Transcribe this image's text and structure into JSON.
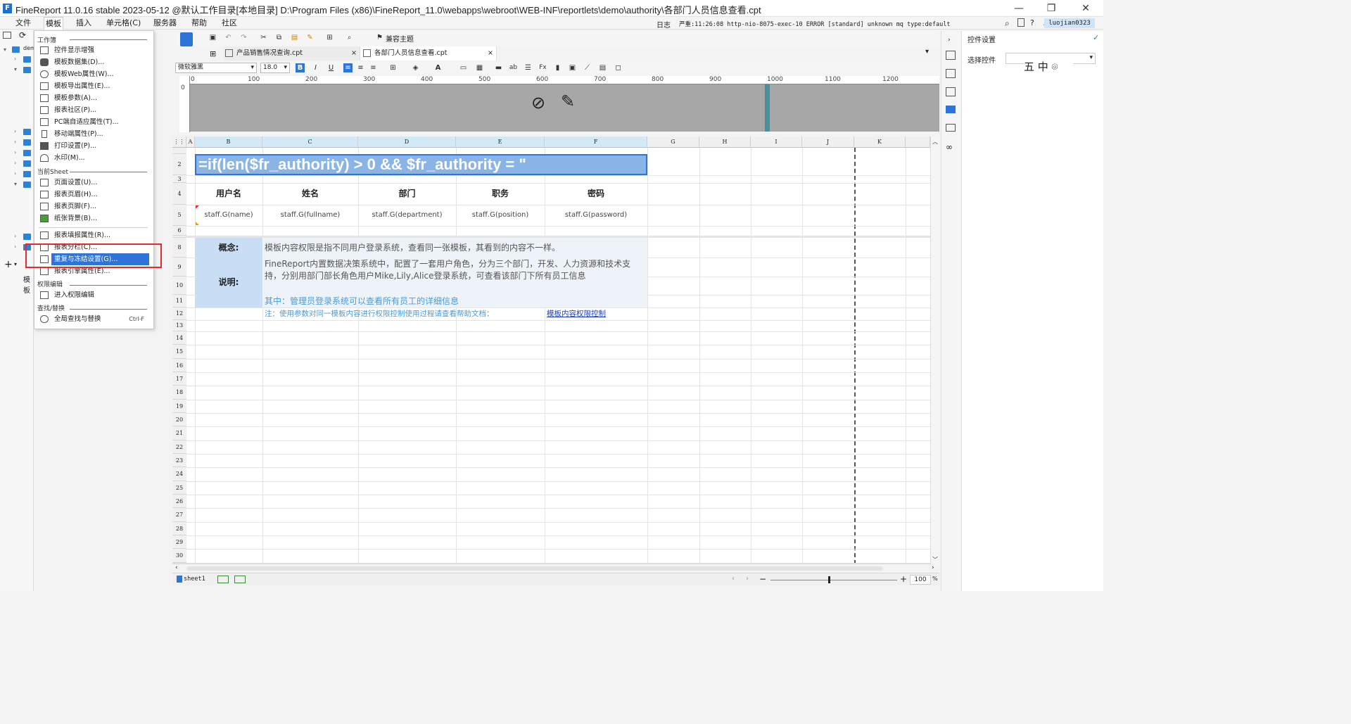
{
  "window": {
    "title": "FineReport 11.0.16 stable 2023-05-12 @默认工作目录[本地目录]    D:\\Program Files (x86)\\FineReport_11.0\\webapps\\webroot\\WEB-INF\\reportlets\\demo\\authority\\各部门人员信息查看.cpt",
    "logo": "F",
    "minimize": "—",
    "restore": "❐",
    "close": "✕"
  },
  "menubar": {
    "items": [
      "文件",
      "模板",
      "插入",
      "单元格(C)",
      "服务器",
      "帮助",
      "社区"
    ],
    "log_label": "日志",
    "log_text": "严重:11:26:08 http-nio-8075-exec-10 ERROR [standard] unknown mq type:default",
    "user": "luojian0323"
  },
  "left_tree": {
    "root_label": "dem",
    "bottom_label": "模板"
  },
  "dropdown": {
    "workbook_head": "工作簿",
    "workbook_items": [
      {
        "label": "控件显示增强",
        "shortcut": ""
      },
      {
        "label": "模板数据集(D)...",
        "shortcut": ""
      },
      {
        "label": "模板Web属性(W)...",
        "shortcut": ""
      },
      {
        "label": "模板导出属性(E)...",
        "shortcut": ""
      },
      {
        "label": "模板参数(A)...",
        "shortcut": ""
      },
      {
        "label": "报表社区(P)...",
        "shortcut": ""
      },
      {
        "label": "PC端自适应属性(T)...",
        "shortcut": ""
      },
      {
        "label": "移动端属性(P)...",
        "shortcut": ""
      },
      {
        "label": "打印设置(P)...",
        "shortcut": ""
      },
      {
        "label": "水印(M)...",
        "shortcut": ""
      }
    ],
    "sheet_head": "当前Sheet",
    "sheet_items": [
      {
        "label": "页面设置(U)...",
        "shortcut": ""
      },
      {
        "label": "报表页眉(H)...",
        "shortcut": ""
      },
      {
        "label": "报表页脚(F)...",
        "shortcut": ""
      },
      {
        "label": "纸张背景(B)...",
        "shortcut": ""
      },
      {
        "label": "报表填报属性(R)...",
        "shortcut": ""
      },
      {
        "label": "报表分栏(C)...",
        "shortcut": ""
      },
      {
        "label": "重复与冻结设置(G)...",
        "shortcut": ""
      },
      {
        "label": "报表引擎属性(E)...",
        "shortcut": ""
      }
    ],
    "perm_head": "权限编辑",
    "perm_items": [
      {
        "label": "进入权限编辑",
        "shortcut": ""
      }
    ],
    "find_head": "查找/替换",
    "find_items": [
      {
        "label": "全局查找与替换",
        "shortcut": "Ctrl-F"
      }
    ]
  },
  "toolbar": {
    "theme_label": "兼容主题",
    "font_name": "微软雅黑",
    "font_size": "18.0"
  },
  "tabs": [
    {
      "label": "产品销售情况查询.cpt",
      "close": "×"
    },
    {
      "label": "各部门人员信息查看.cpt",
      "close": "×"
    }
  ],
  "ruler": {
    "ticks": [
      "0",
      "100",
      "200",
      "300",
      "400",
      "500",
      "600",
      "700",
      "800",
      "900",
      "1000",
      "1100",
      "1200"
    ],
    "vtick": "0"
  },
  "grid": {
    "columns": [
      "A",
      "B",
      "C",
      "D",
      "E",
      "F",
      "G",
      "H",
      "I",
      "J",
      "K"
    ],
    "rows": [
      "1",
      "2",
      "3",
      "4",
      "5",
      "6",
      "7",
      "8",
      "9",
      "10",
      "11",
      "12",
      "13",
      "14",
      "15",
      "16",
      "17",
      "18",
      "19",
      "20",
      "21",
      "22",
      "23",
      "24",
      "25",
      "26",
      "27",
      "28",
      "29",
      "30"
    ],
    "formula_cell": "=if(len($fr_authority) > 0 && $fr_authority = \"",
    "headers": [
      "用户名",
      "姓名",
      "部门",
      "职务",
      "密码"
    ],
    "data_cells": [
      "staff.G(name)",
      "staff.G(fullname)",
      "staff.G(department)",
      "staff.G(position)",
      "staff.G(password)"
    ],
    "concept_label": "概念:",
    "concept_text": "模板内容权限是指不同用户登录系统，查看同一张模板，其看到的内容不一样。",
    "desc_label": "说明:",
    "desc_text": "FineReport内置数据决策系统中，配置了一套用户角色，分为三个部门，开发、人力资源和技术支持，分别用部门部长角色用户Mike,Lily,Alice登录系统，可查看该部门下所有员工信息",
    "desc_admin": "其中：管理员登录系统可以查看所有员工的详细信息",
    "note_text": "注：使用参数对同一模板内容进行权限控制使用过程请查看帮助文档：",
    "note_link": "模板内容权限控制"
  },
  "right_panel": {
    "title": "控件设置",
    "select_label": "选择控件",
    "chars": "五 中 ⌾"
  },
  "statusbar": {
    "sheet": "sheet1",
    "zoom": "100",
    "zoom_unit": "%",
    "minus": "−",
    "plus": "+"
  },
  "help_button": "?",
  "colors": {
    "accent": "#2e74d8",
    "highlight_red": "#e8292b",
    "formula_bg": "#8ab3e6",
    "concept_bg": "#c9def4"
  }
}
